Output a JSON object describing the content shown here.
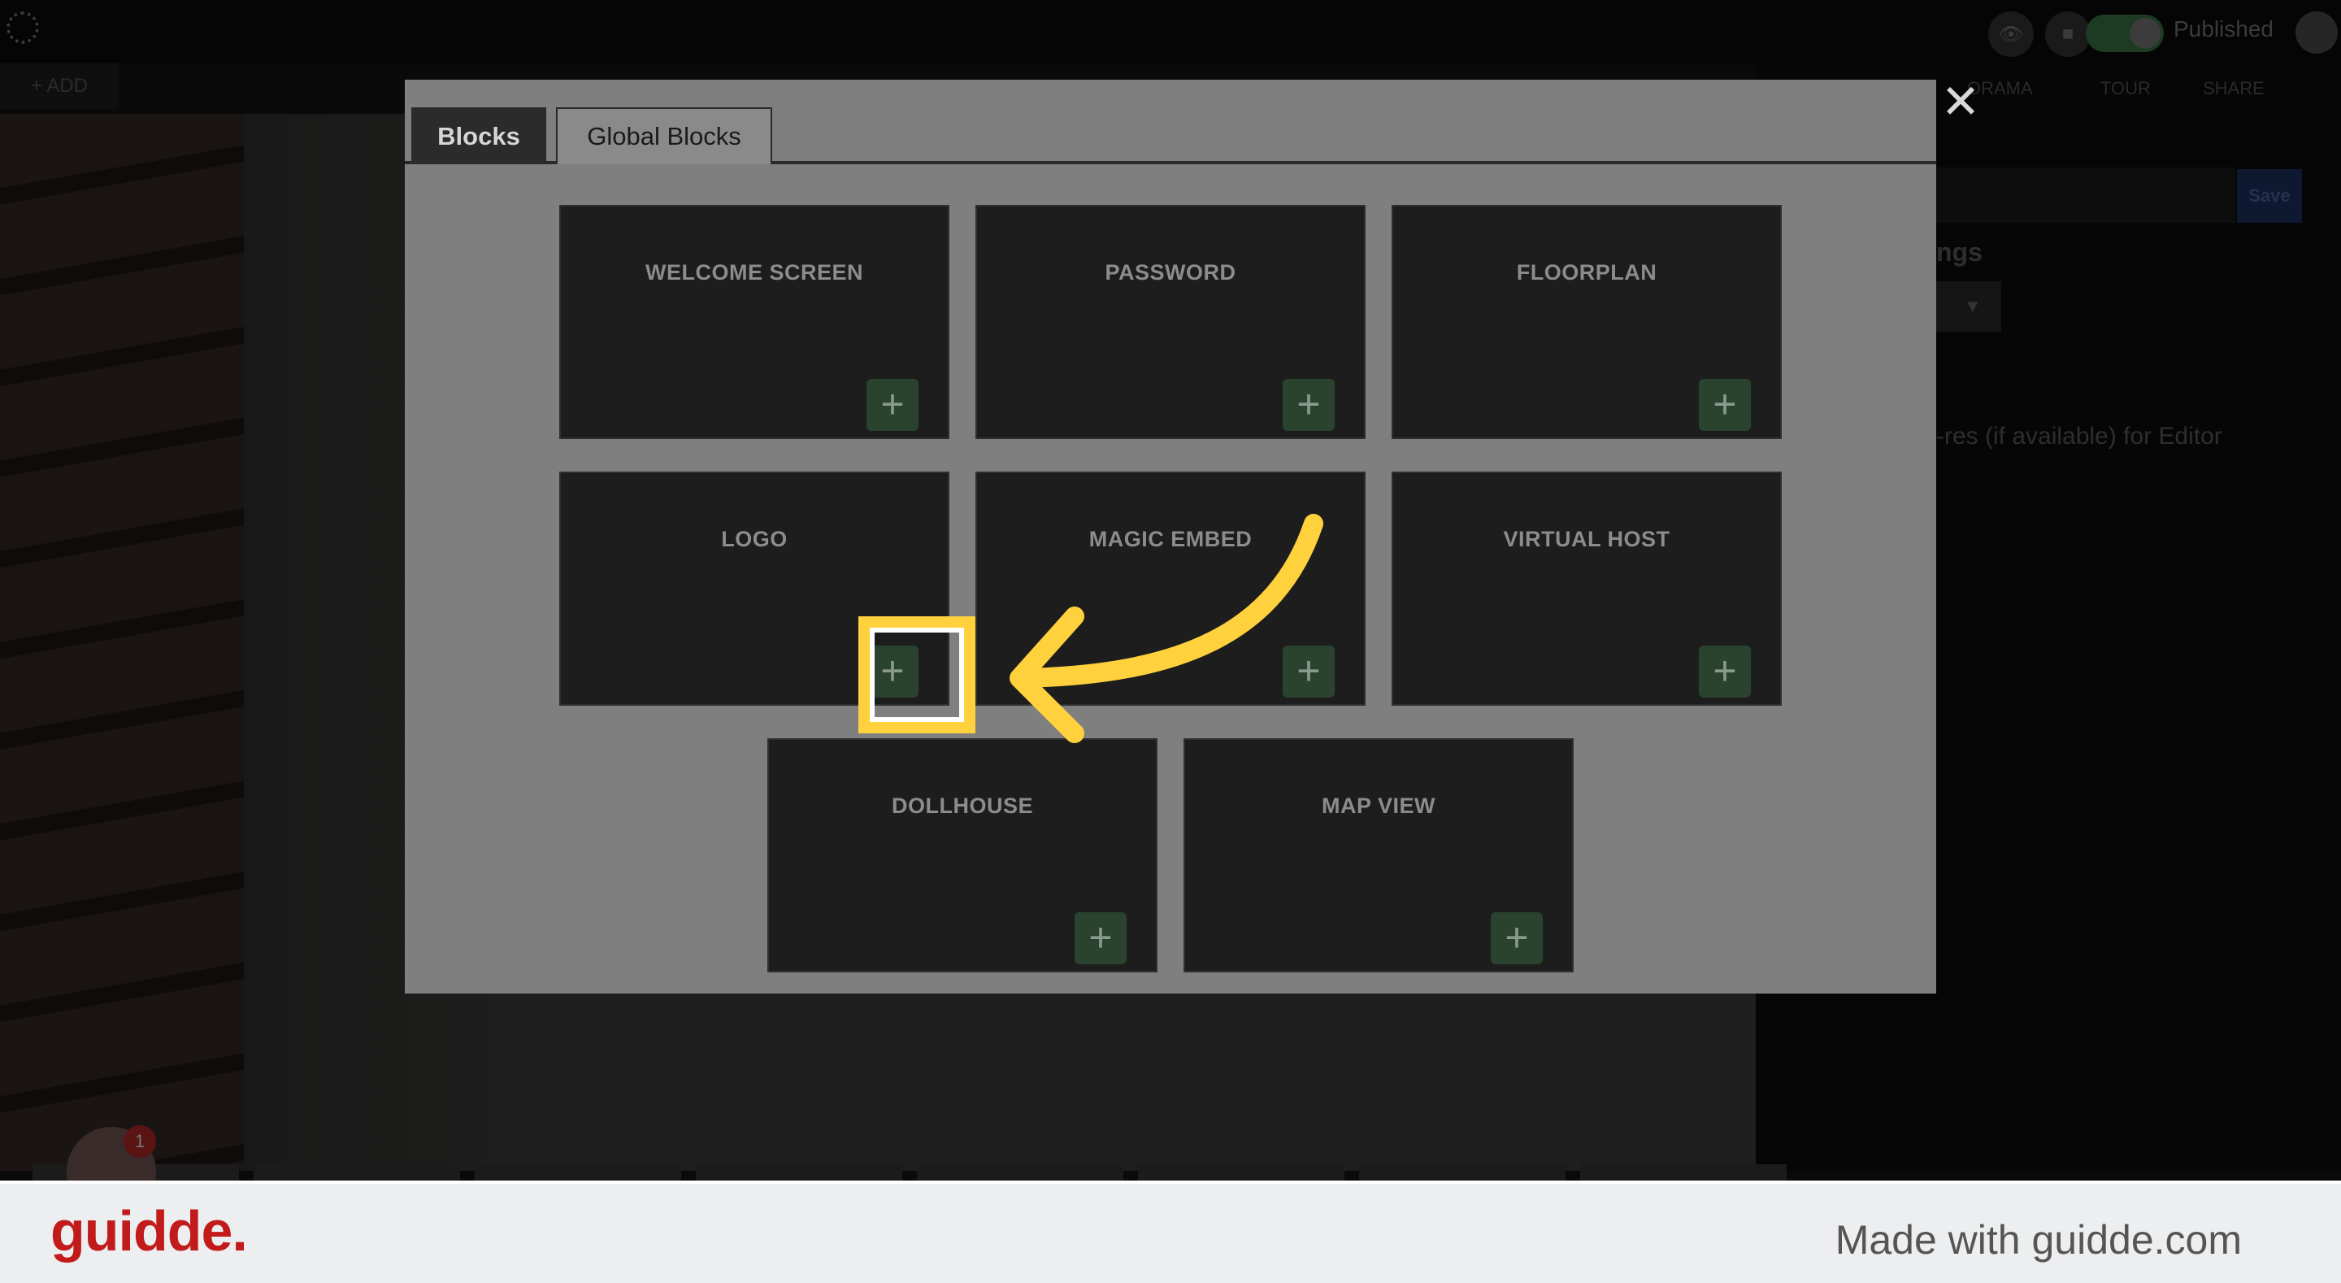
{
  "topbar": {
    "app_logo_icon": "gear-logo-icon",
    "preview_icon": "eye-icon",
    "save_icon": "floppy-disk-icon",
    "published_label": "Published",
    "add_label": "+ ADD"
  },
  "right_panel": {
    "tabs": [
      "ORAMA",
      "TOUR",
      "SHARE"
    ],
    "save_label": "Save",
    "heading": "ngs",
    "text": "-res (if available) for Editor"
  },
  "modal": {
    "tabs": [
      {
        "label": "Blocks",
        "active": true
      },
      {
        "label": "Global Blocks",
        "active": false
      }
    ],
    "close_icon": "close-icon",
    "blocks": [
      {
        "title": "WELCOME SCREEN"
      },
      {
        "title": "PASSWORD"
      },
      {
        "title": "FLOORPLAN"
      },
      {
        "title": "LOGO"
      },
      {
        "title": "MAGIC EMBED"
      },
      {
        "title": "VIRTUAL HOST"
      },
      {
        "title": "DOLLHOUSE"
      },
      {
        "title": "MAP VIEW"
      }
    ],
    "add_symbol": "+"
  },
  "guidde": {
    "badge_count": "1",
    "footer_logo": "guidde.",
    "footer_text": "Made with guidde.com"
  },
  "colors": {
    "highlight": "#ffd13c",
    "add_button": "#29432f",
    "brand_red": "#c21b1b"
  }
}
